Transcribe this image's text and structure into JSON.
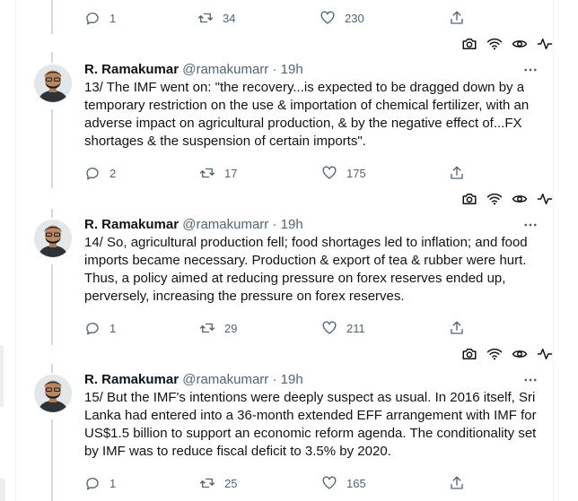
{
  "tweets": [
    {
      "actions": {
        "replies": "1",
        "retweets": "34",
        "likes": "230"
      }
    },
    {
      "author": {
        "name": "R. Ramakumar",
        "handle": "@ramakumarr",
        "time": "19h"
      },
      "text": "13/ The IMF went on: \"the recovery...is expected to be dragged down by a temporary restriction on the use & importation of chemical fertilizer, with an adverse impact on agricultural production, & by the negative effect of...FX shortages & the suspension of certain imports\".",
      "actions": {
        "replies": "2",
        "retweets": "17",
        "likes": "175"
      }
    },
    {
      "author": {
        "name": "R. Ramakumar",
        "handle": "@ramakumarr",
        "time": "19h"
      },
      "text": "14/ So, agricultural production fell; food shortages led to inflation; and food imports became necessary. Production & export of tea & rubber were hurt. Thus, a policy aimed at reducing pressure on forex reserves ended up, perversely, increasing the pressure on forex reserves.",
      "actions": {
        "replies": "1",
        "retweets": "29",
        "likes": "211"
      }
    },
    {
      "author": {
        "name": "R. Ramakumar",
        "handle": "@ramakumarr",
        "time": "19h"
      },
      "text": "15/ But the IMF's intentions were deeply suspect as usual. In 2016 itself, Sri Lanka had entered into a 36-month extended EFF arrangement with IMF for US$1.5 billion to support an economic reform agenda. The conditionality set by IMF was to reduce fiscal deficit to 3.5% by 2020.",
      "actions": {
        "replies": "1",
        "retweets": "25",
        "likes": "165"
      }
    }
  ],
  "separator": " · ",
  "icons": {
    "reply": "reply-icon",
    "retweet": "retweet-icon",
    "like": "heart-icon",
    "share": "share-icon",
    "more": "more-icon",
    "camera": "camera-icon",
    "wifi": "wifi-icon",
    "eye": "eye-icon",
    "activity": "activity-icon"
  },
  "colors": {
    "text": "#0f1419",
    "muted": "#536471",
    "thread_line": "#cfd9de",
    "border": "#eff3f4"
  }
}
